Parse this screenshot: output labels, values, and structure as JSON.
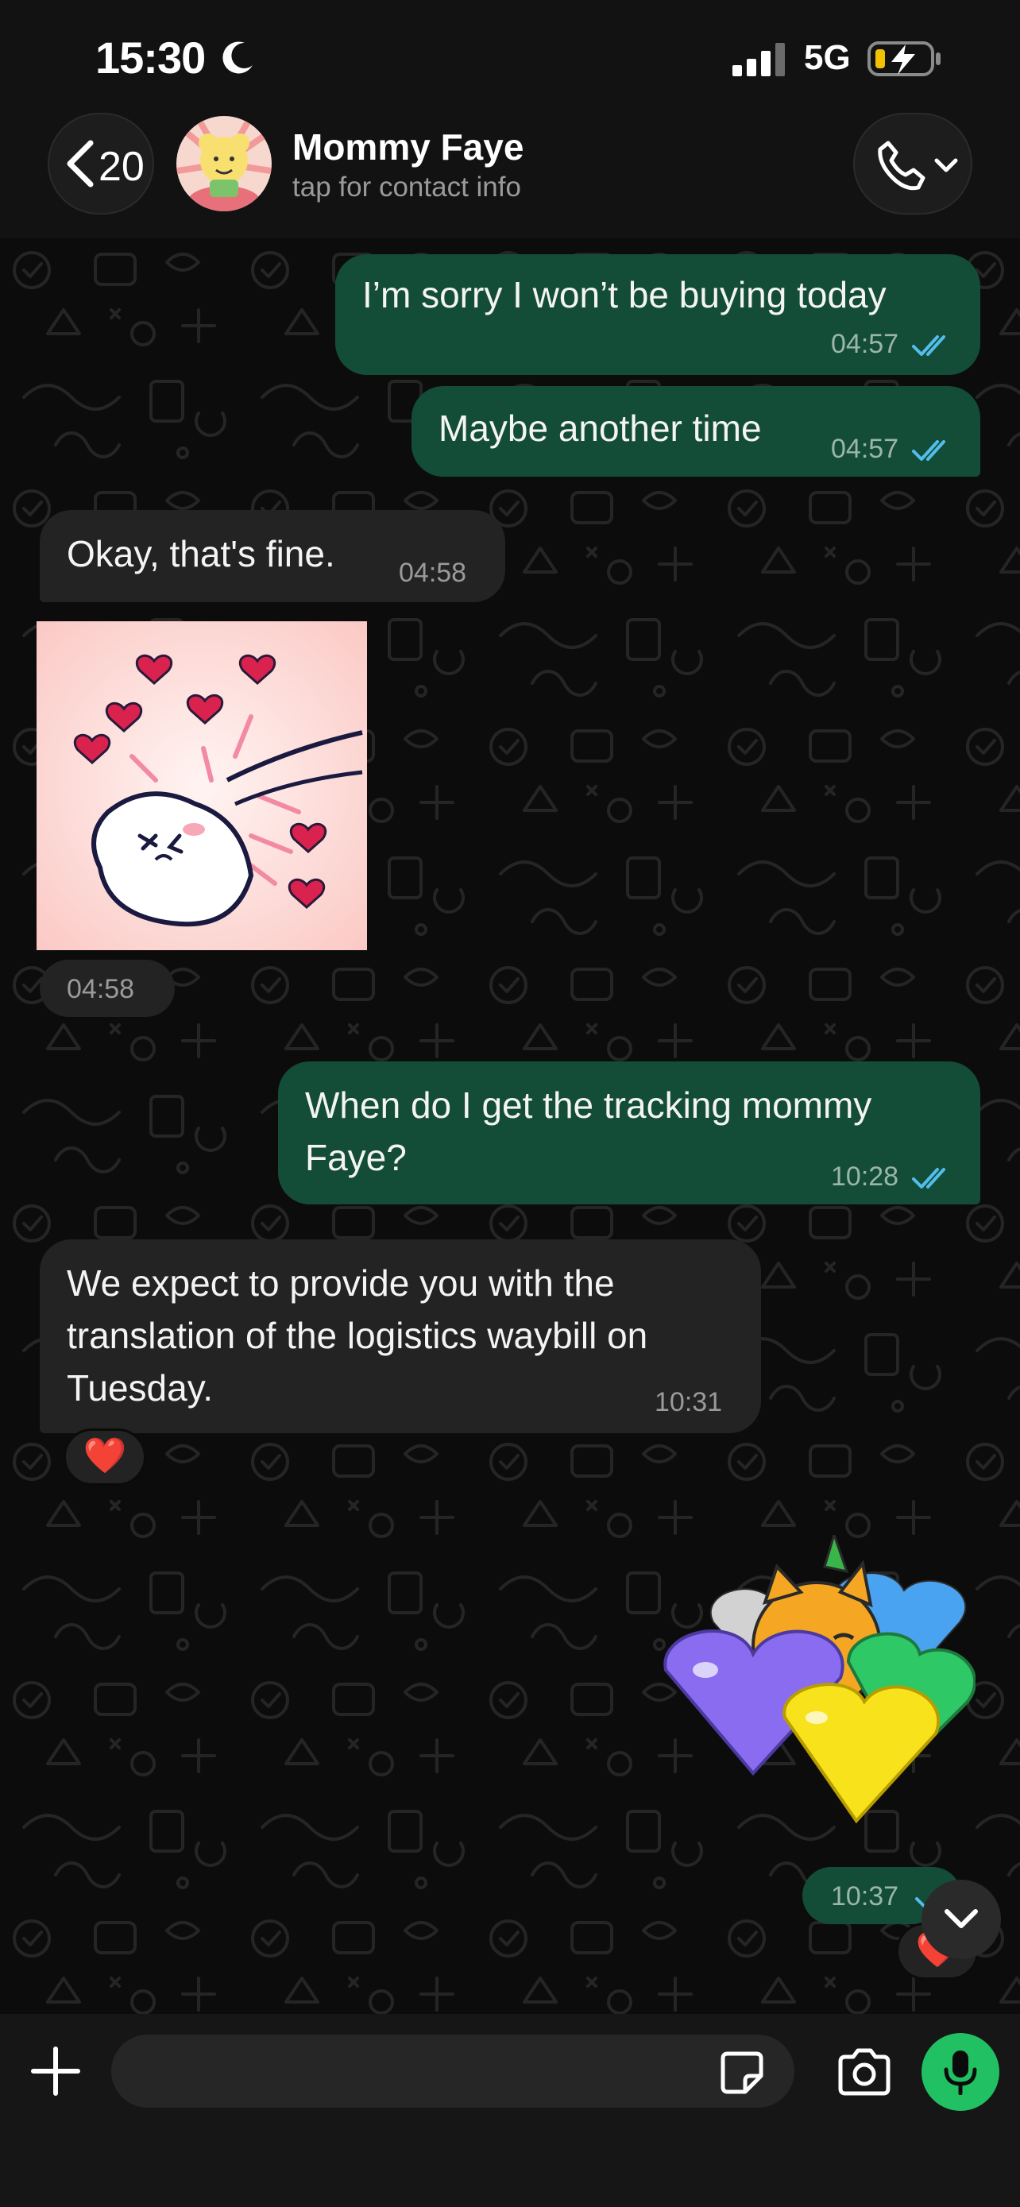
{
  "status_bar": {
    "time": "15:30",
    "network": "5G",
    "icons": [
      "moon-icon",
      "signal-icon",
      "battery-charging-icon"
    ]
  },
  "header": {
    "back_count": "20",
    "contact_name": "Mommy Faye",
    "contact_subtitle": "tap for contact info",
    "icons": [
      "chevron-left-icon",
      "phone-icon",
      "chevron-down-icon"
    ]
  },
  "messages": [
    {
      "direction": "outgoing",
      "text": "I’m sorry I won’t be buying today",
      "time": "04:57",
      "status": "read"
    },
    {
      "direction": "outgoing",
      "text": "Maybe another time",
      "time": "04:57",
      "status": "read"
    },
    {
      "direction": "incoming",
      "text": "Okay, that's fine.",
      "time": "04:58"
    },
    {
      "direction": "incoming",
      "type": "sticker",
      "sticker": "hamster-hearts-sticker",
      "time": "04:58"
    },
    {
      "direction": "outgoing",
      "text": "When do I get the tracking mommy\nFaye?",
      "time": "10:28",
      "status": "read"
    },
    {
      "direction": "incoming",
      "text": "We expect to provide you with the\ntranslation of the logistics waybill on\nTuesday.",
      "time": "10:31",
      "reaction": "❤️"
    },
    {
      "direction": "outgoing",
      "type": "sticker",
      "sticker": "cat-balloon-hearts-sticker",
      "time": "10:37",
      "status": "read",
      "reaction": "❤️"
    }
  ],
  "input_bar": {
    "placeholder": "",
    "icons": [
      "plus-icon",
      "sticker-icon",
      "camera-icon",
      "microphone-icon"
    ]
  },
  "colors": {
    "outgoing_bubble": "#134d37",
    "incoming_bubble": "#232323",
    "read_ticks": "#53bdeb",
    "mic_button": "#21c063",
    "background": "#0b0b0b"
  }
}
